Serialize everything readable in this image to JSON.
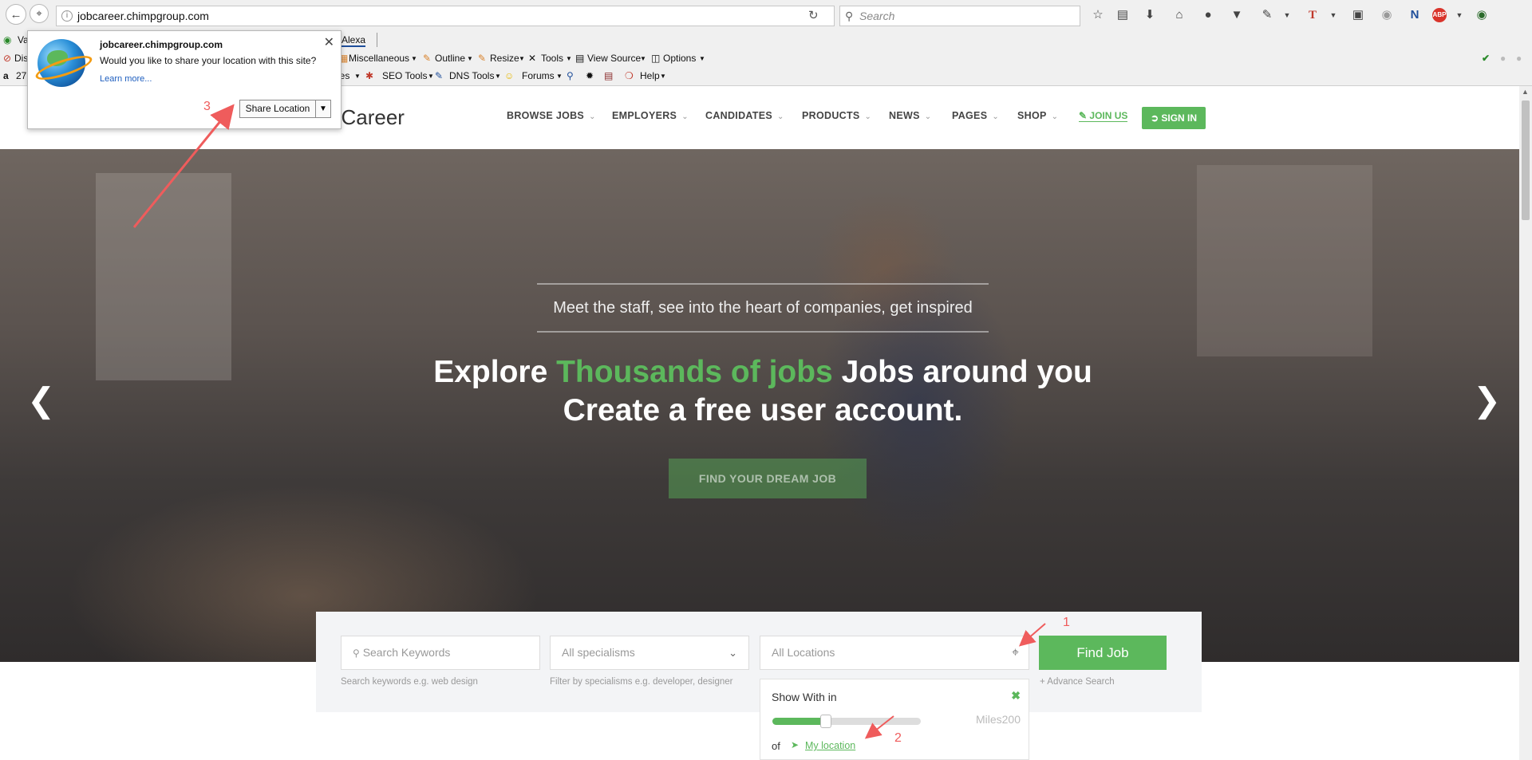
{
  "browser": {
    "url_host": "jobcareer.chimpgroup.com",
    "search_placeholder": "Search"
  },
  "toolbar_row1": {
    "item1": "Va",
    "alexa": "Alexa"
  },
  "toolbar_row2": {
    "item1": "Dis",
    "miscellaneous": "Miscellaneous",
    "outline": "Outline",
    "resize": "Resize",
    "tools": "Tools",
    "view_source": "View Source",
    "options": "Options"
  },
  "toolbar_row3": {
    "item1": "27",
    "item2": "nes",
    "seo_tools": "SEO Tools",
    "dns_tools": "DNS Tools",
    "forums": "Forums",
    "help": "Help"
  },
  "geo_popup": {
    "site": "jobcareer.chimpgroup.com",
    "question": "Would you like to share your location with this site?",
    "learn_more": "Learn more...",
    "share_button": "Share Location"
  },
  "header": {
    "logo_text": "bCareer",
    "nav": [
      "BROWSE JOBS",
      "EMPLOYERS",
      "CANDIDATES",
      "PRODUCTS",
      "NEWS",
      "PAGES",
      "SHOP"
    ],
    "join": "JOIN US",
    "signin": "SIGN IN"
  },
  "hero": {
    "tagline": "Meet the staff, see into the heart of companies, get inspired",
    "title_part1": "Explore ",
    "title_highlight": "Thousands of jobs",
    "title_part2": " Jobs around you",
    "title_line2": "Create a free user account.",
    "cta": "FIND YOUR DREAM JOB"
  },
  "search": {
    "keywords_placeholder": "Search Keywords",
    "keywords_hint": "Search keywords e.g. web design",
    "specialisms": "All specialisms",
    "specialisms_hint": "Filter by specialisms e.g. developer, designer",
    "locations_placeholder": "All Locations",
    "find_button": "Find Job",
    "advance": "+ Advance Search"
  },
  "radius": {
    "title": "Show With in",
    "miles": "Miles200",
    "of": "of",
    "my_location": "My location",
    "slider_fraction": 0.36
  },
  "annotations": [
    "1",
    "2",
    "3"
  ],
  "colors": {
    "brand_green": "#5cb85c",
    "annotation": "#ef5c5c"
  }
}
